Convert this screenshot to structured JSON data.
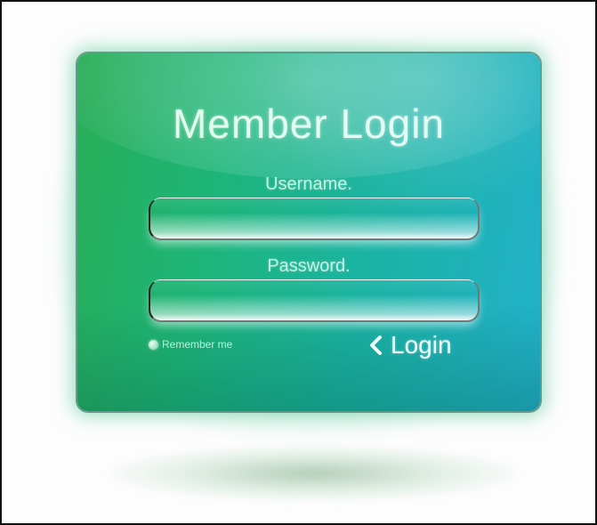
{
  "login_panel": {
    "title": "Member Login",
    "username_label": "Username.",
    "username_value": "",
    "password_label": "Password.",
    "password_value": "",
    "remember_label": "Remember me",
    "login_label": "Login",
    "icons": {
      "login": "chevron-left-icon",
      "remember": "radio-dot-icon"
    },
    "colors": {
      "panel_left": "#28ad55",
      "panel_right": "#22b2cc",
      "text": "#ebfff5"
    }
  }
}
